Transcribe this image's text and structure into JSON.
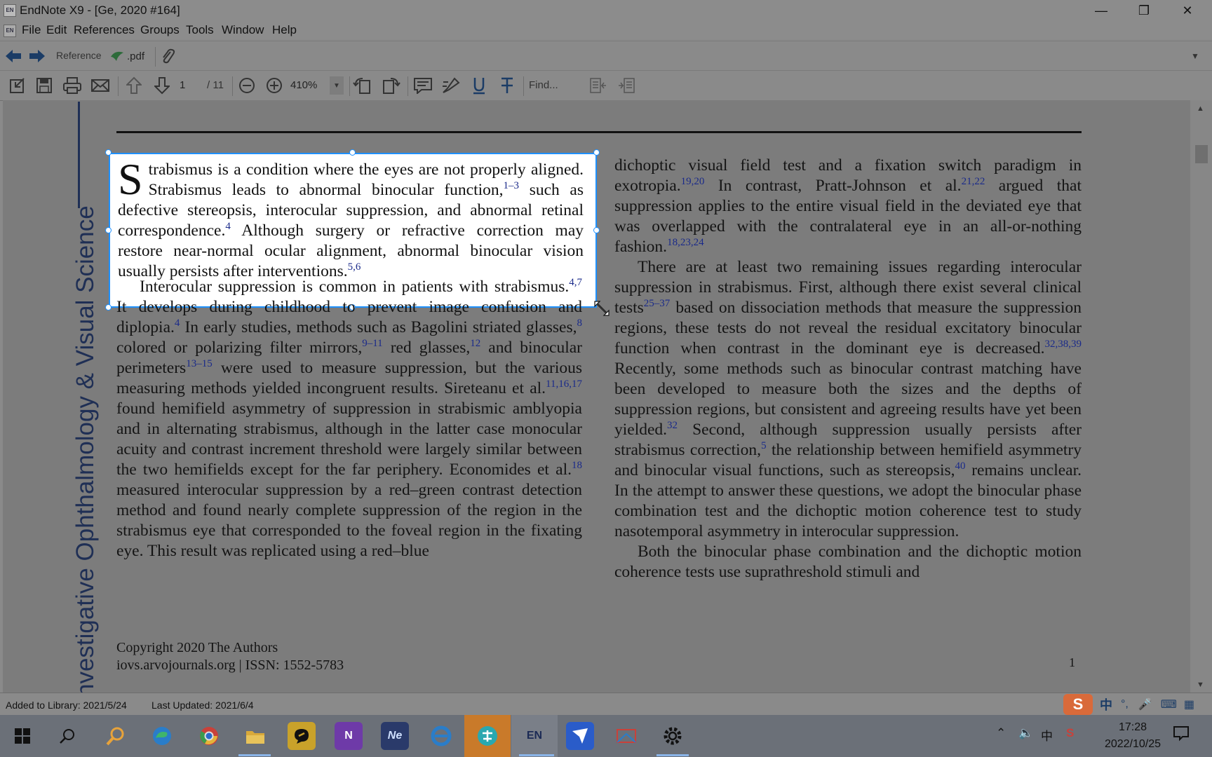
{
  "app": {
    "icon": "EN",
    "title": "EndNote X9 - [Ge, 2020 #164]"
  },
  "menu": [
    "File",
    "Edit",
    "References",
    "Groups",
    "Tools",
    "Window",
    "Help"
  ],
  "nav": {
    "reference_label": "Reference",
    "pdf_label": ".pdf"
  },
  "toolbar": {
    "page_current": "1",
    "page_total": "/ 11",
    "zoom": "410%",
    "find_placeholder": "Find..."
  },
  "document": {
    "journal_vertical": "nvestigative Ophthalmology & Visual Science",
    "selected_paragraph": {
      "dropcap": "S",
      "lines": [
        {
          "text": "trabismus is a condition where the eyes are not properly aligned. Strabismus leads to abnormal binocular function,",
          "sup": "1–3"
        },
        {
          "text": " such as defective stereopsis, interocular suppression, and abnormal retinal correspondence.",
          "sup": "4"
        },
        {
          "text": " Although surgery or refractive correction may restore near-normal ocular alignment, abnormal binocular vision usually persists after interventions.",
          "sup": "5,6"
        }
      ]
    },
    "left_column": [
      {
        "text": "Interocular suppression is common in patients with strabismus.",
        "sup": "4,7"
      },
      {
        "text": " It develops during childhood to prevent image confusion and diplopia.",
        "sup": "4"
      },
      {
        "text": " In early studies, methods such as Bagolini striated glasses,",
        "sup": "8"
      },
      {
        "text": " colored or polarizing filter mirrors,",
        "sup": "9–11"
      },
      {
        "text": " red glasses,",
        "sup": "12"
      },
      {
        "text": " and binocular perimeters",
        "sup": "13–15"
      },
      {
        "text": " were used to measure suppression, but the various measuring methods yielded incongruent results. Sireteanu et al.",
        "sup": "11,16,17"
      },
      {
        "text": " found hemifield asymmetry of suppression in strabismic amblyopia and in alternating strabismus, although in the latter case monocular acuity and contrast increment threshold were largely similar between the two hemifields except for the far periphery. Economides et al.",
        "sup": "18"
      },
      {
        "text": " measured interocular suppression by a red–green contrast detection method and found nearly complete suppression of the region in the strabismus eye that corresponded to the foveal region in the fixating eye. This result was replicated using a red–blue",
        "sup": ""
      }
    ],
    "right_column_p1": [
      {
        "text": "dichoptic visual field test and a fixation switch paradigm in exotropia.",
        "sup": "19,20"
      },
      {
        "text": " In contrast, Pratt-Johnson et al.",
        "sup": "21,22"
      },
      {
        "text": " argued that suppression applies to the entire visual field in the deviated eye that was overlapped with the contralateral eye in an all-or-nothing fashion.",
        "sup": "18,23,24"
      }
    ],
    "right_column_p2": [
      {
        "text": "There are at least two remaining issues regarding interocular suppression in strabismus. First, although there exist several clinical tests",
        "sup": "25–37"
      },
      {
        "text": " based on dissociation methods that measure the suppression regions, these tests do not reveal the residual excitatory binocular function when contrast in the dominant eye is decreased.",
        "sup": "32,38,39"
      },
      {
        "text": " Recently, some methods such as binocular contrast matching have been developed to measure both the sizes and the depths of suppression regions, but consistent and agreeing results have yet been yielded.",
        "sup": "32"
      },
      {
        "text": " Second, although suppression usually persists after strabismus correction,",
        "sup": "5"
      },
      {
        "text": " the relationship between hemifield asymmetry and binocular visual functions, such as stereopsis,",
        "sup": "40"
      },
      {
        "text": " remains unclear. In the attempt to answer these questions, we adopt the binocular phase combination test and the dichoptic motion coherence test to study nasotemporal asymmetry in interocular suppression.",
        "sup": ""
      }
    ],
    "right_column_p3": [
      {
        "text": "Both the binocular phase combination and the dichoptic motion coherence tests use suprathreshold stimuli and",
        "sup": ""
      }
    ],
    "copyright": "Copyright 2020 The Authors",
    "footer_partial": "iovs.arvojournals.org | ISSN: 1552-5783",
    "page_number": "1"
  },
  "status": {
    "added": "Added to Library: 2021/5/24",
    "updated": "Last Updated: 2021/6/4"
  },
  "taskbar": {
    "time": "17:28",
    "date": "2022/10/25",
    "ime_lang": "中",
    "apps": [
      "windows-start",
      "search",
      "search-tool",
      "edge",
      "chrome",
      "file-explorer",
      "quick-notes",
      "onenote",
      "notation",
      "ie-edge",
      "translator",
      "endnote",
      "mail",
      "office",
      "settings"
    ]
  },
  "colors": {
    "selection": "#1e90ff",
    "journal": "#1f2f55",
    "citation": "#1a2a8a",
    "taskbar": "#6b7078"
  }
}
